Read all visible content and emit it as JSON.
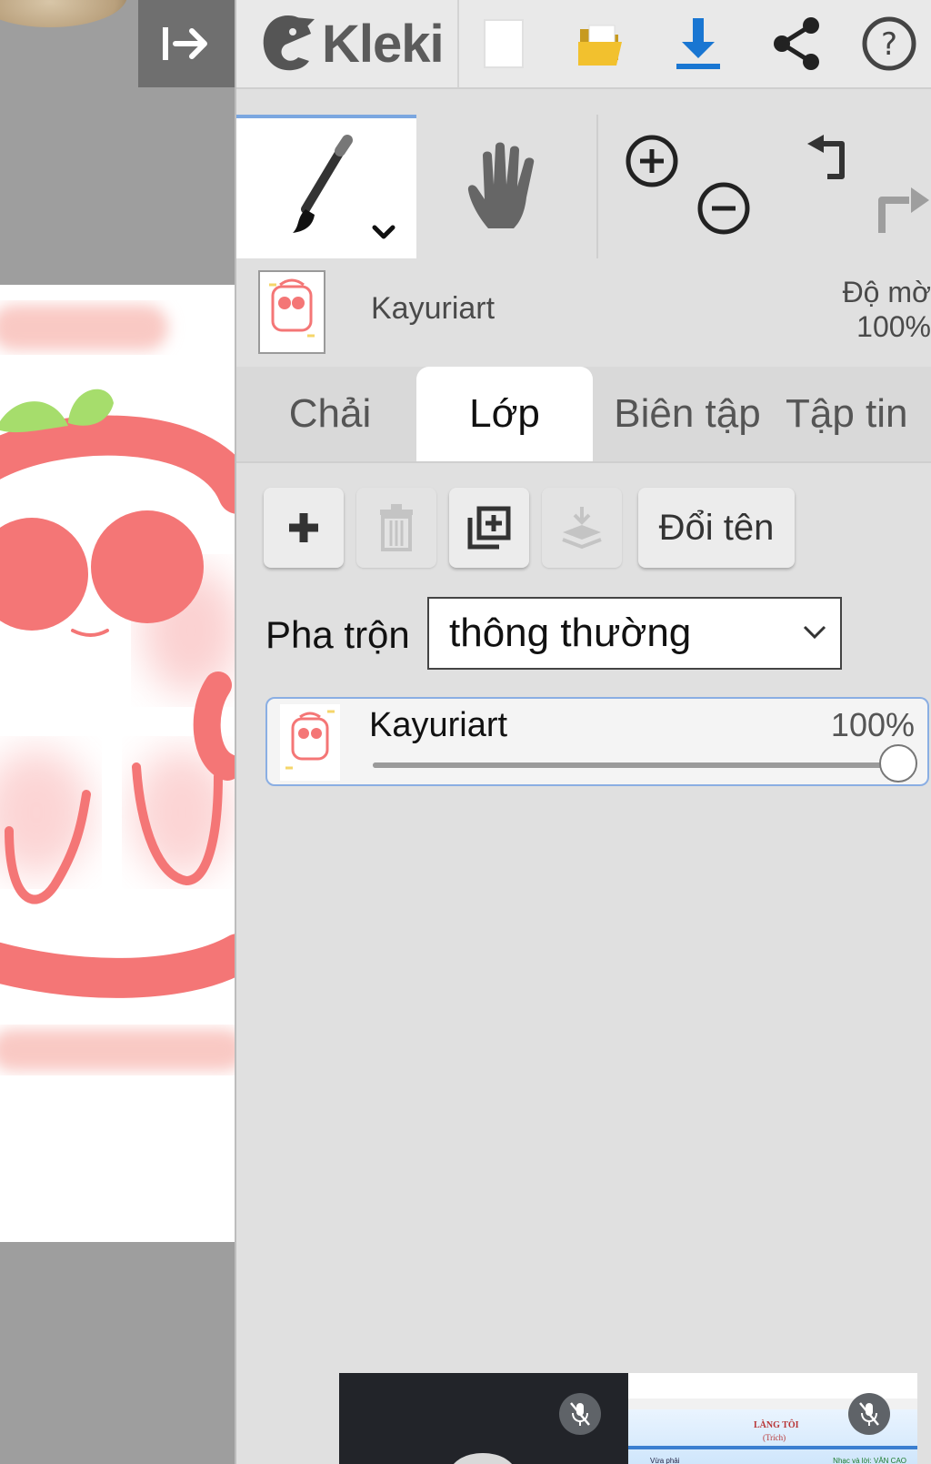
{
  "app": {
    "logo_text": "Kleki"
  },
  "colors": {
    "accent": "#7ba7e0",
    "canvas_stroke": "#f47676",
    "canvas_leaf": "#a6dd6c",
    "download_icon": "#1976d2",
    "open_icon": "#f2c12e"
  },
  "toolbar": {
    "icons": [
      "new-image-icon",
      "open-folder-icon",
      "download-icon",
      "share-icon",
      "help-icon"
    ]
  },
  "tools": {
    "active_tool": "brush",
    "icons": [
      "brush-icon",
      "hand-icon",
      "zoom-in-icon",
      "zoom-out-icon",
      "undo-icon",
      "redo-icon"
    ]
  },
  "layer_info": {
    "name": "Kayuriart",
    "opacity_label": "Độ mờ",
    "opacity_value": "100%"
  },
  "tabs": [
    {
      "label": "Chải",
      "active": false
    },
    {
      "label": "Lớp",
      "active": true
    },
    {
      "label": "Biên tập",
      "active": false
    },
    {
      "label": "Tập tin",
      "active": false
    }
  ],
  "layer_tools": {
    "rename_label": "Đổi tên"
  },
  "blend": {
    "label": "Pha trộn",
    "value": "thông thường"
  },
  "layers": [
    {
      "name": "Kayuriart",
      "opacity_label": "100%",
      "opacity": 1.0
    }
  ],
  "video_call": {
    "slide_title": "LÀNG TÔI",
    "slide_subtitle": "(Trích)",
    "slide_left_caption": "Vừa phải",
    "slide_right_caption": "Nhạc và lời: VĂN CAO"
  }
}
